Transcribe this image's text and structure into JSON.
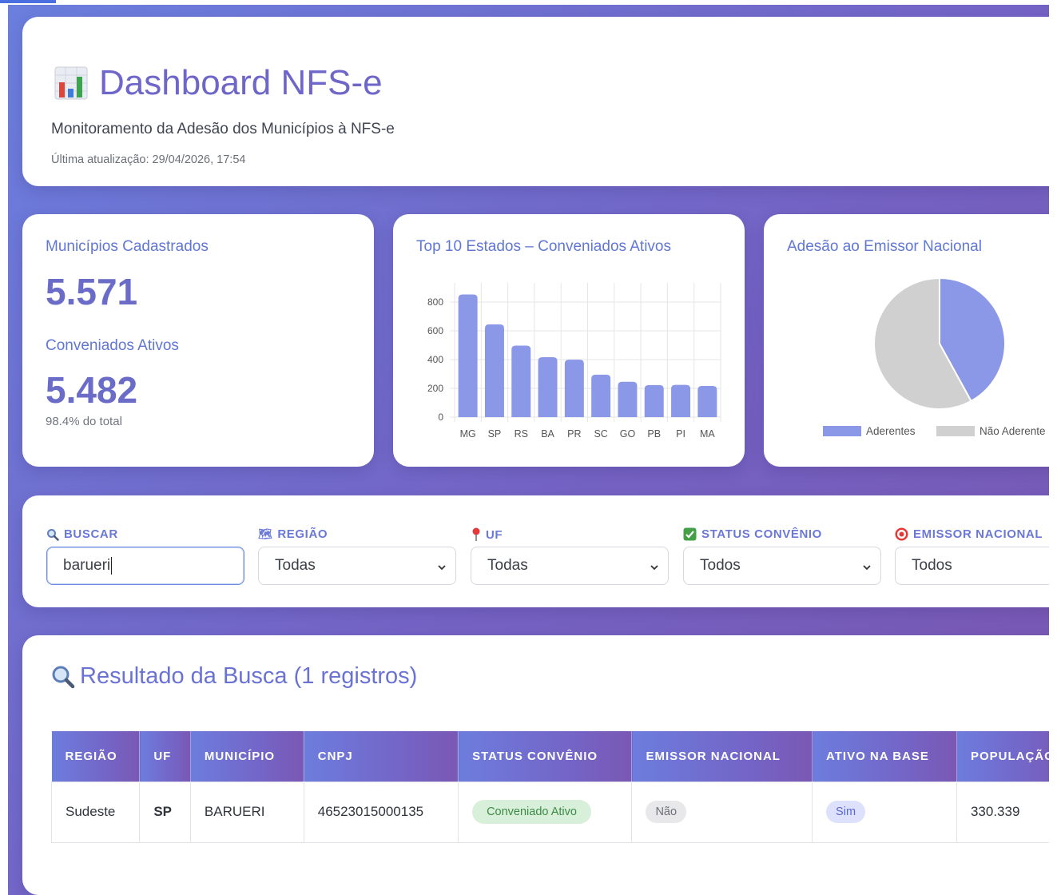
{
  "header": {
    "title": "Dashboard NFS-e",
    "subtitle": "Monitoramento da Adesão dos Municípios à NFS-e",
    "updated": "Última atualização: 29/04/2026, 17:54"
  },
  "stats": {
    "registered_label": "Municípios Cadastrados",
    "registered_value": "5.571",
    "active_label": "Conveniados Ativos",
    "active_value": "5.482",
    "active_note": "98.4% do total"
  },
  "chart_data": [
    {
      "type": "bar",
      "title": "Top 10 Estados – Conveniados Ativos",
      "categories": [
        "MG",
        "SP",
        "RS",
        "BA",
        "PR",
        "SC",
        "GO",
        "PB",
        "PI",
        "MA"
      ],
      "values": [
        853,
        645,
        497,
        417,
        399,
        295,
        246,
        223,
        224,
        217
      ],
      "ylim": [
        0,
        900
      ],
      "yticks": [
        0,
        200,
        400,
        600,
        800
      ],
      "grid": true,
      "color": "#8b98e8"
    },
    {
      "type": "pie",
      "title": "Adesão ao Emissor Nacional",
      "labels": [
        "Aderentes",
        "Não Aderentes"
      ],
      "legend_visible_text": [
        "Aderentes",
        "Não Aderente"
      ],
      "values": [
        42,
        58
      ],
      "colors": [
        "#8b98e8",
        "#d0d0d0"
      ],
      "legend": "bottom"
    }
  ],
  "filters": {
    "search_label": "BUSCAR",
    "search_value": "barueri",
    "region_label": "REGIÃO",
    "region_value": "Todas",
    "uf_label": "UF",
    "uf_value": "Todas",
    "status_label": "STATUS CONVÊNIO",
    "status_value": "Todos",
    "emissor_label": "EMISSOR NACIONAL",
    "emissor_value": "Todos"
  },
  "results": {
    "title": "Resultado da Busca (1 registros)",
    "columns": [
      "REGIÃO",
      "UF",
      "MUNICÍPIO",
      "CNPJ",
      "STATUS CONVÊNIO",
      "EMISSOR NACIONAL",
      "ATIVO NA BASE",
      "POPULAÇÃO"
    ],
    "rows": [
      {
        "regiao": "Sudeste",
        "uf": "SP",
        "municipio": "BARUERI",
        "cnpj": "46523015000135",
        "status": "Conveniado Ativo",
        "emissor": "Não",
        "ativo": "Sim",
        "populacao": "330.339"
      }
    ]
  },
  "colors": {
    "accent": "#6e67c9",
    "bar": "#8b98e8",
    "pie_other": "#d0d0d0",
    "success_bg": "#d8f0da",
    "success_text": "#3d8a46"
  }
}
